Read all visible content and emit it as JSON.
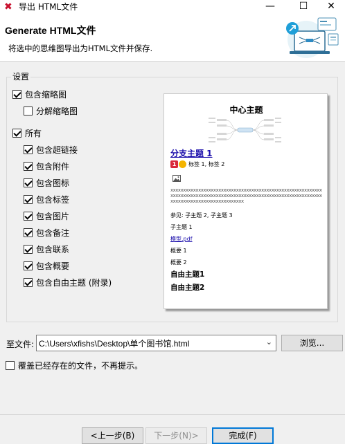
{
  "window": {
    "title": "导出 HTML文件",
    "minimize_glyph": "—",
    "maximize_glyph": "☐",
    "close_glyph": "✕"
  },
  "header": {
    "title": "Generate HTML文件",
    "subtitle": "将选中的思维图导出为HTML文件并保存."
  },
  "settings": {
    "group_label": "设置",
    "options": [
      {
        "label": "包含缩略图",
        "checked": true
      },
      {
        "label": "分解缩略图",
        "checked": false
      },
      {
        "label": "所有",
        "checked": true
      },
      {
        "label": "包含超链接",
        "checked": true
      },
      {
        "label": "包含附件",
        "checked": true
      },
      {
        "label": "包含图标",
        "checked": true
      },
      {
        "label": "包含标签",
        "checked": true
      },
      {
        "label": "包含图片",
        "checked": true
      },
      {
        "label": "包含备注",
        "checked": true
      },
      {
        "label": "包含联系",
        "checked": true
      },
      {
        "label": "包含概要",
        "checked": true
      },
      {
        "label": "包含自由主题 (附录)",
        "checked": true
      }
    ]
  },
  "preview": {
    "central_topic": "中心主题",
    "branch_heading": "分支主题 1",
    "marker_badge": "1",
    "labels_text": "标签 1, 标签 2",
    "note_text": "xxxxxxxxxxxxxxxxxxxxxxxxxxxxxxxxxxxxxxxxxxxxxxxxxxxxxxxxxxxxxxxxxxxxxxxxxxxxxxxxxxxxxxxxxxxxxxxxxxxxxxxxxxxxxxxxxxxxxxxxxxxxxxxxxxxxxxxxxxxxxxxxxxxxx",
    "see_also": "参见:   子主题 2, 子主题 3",
    "subtopic": "子主题 1",
    "attachment_link": "模型.pdf",
    "summary_1": "概要 1",
    "summary_2": "概要 2",
    "free_topic_1": "自由主题1",
    "free_topic_2": "自由主题2"
  },
  "file": {
    "label": "至文件:",
    "value": "C:\\Users\\xfishs\\Desktop\\单个图书馆.html",
    "browse_label": "浏览..."
  },
  "overwrite": {
    "label": "覆盖已经存在的文件，不再提示。",
    "checked": false
  },
  "footer": {
    "back_label": "<上一步(B)",
    "next_label": "下一步(N)>",
    "finish_label": "完成(F)"
  },
  "colors": {
    "accent": "#0078d7",
    "link": "#1a0dab",
    "brand_red": "#c8102e"
  }
}
